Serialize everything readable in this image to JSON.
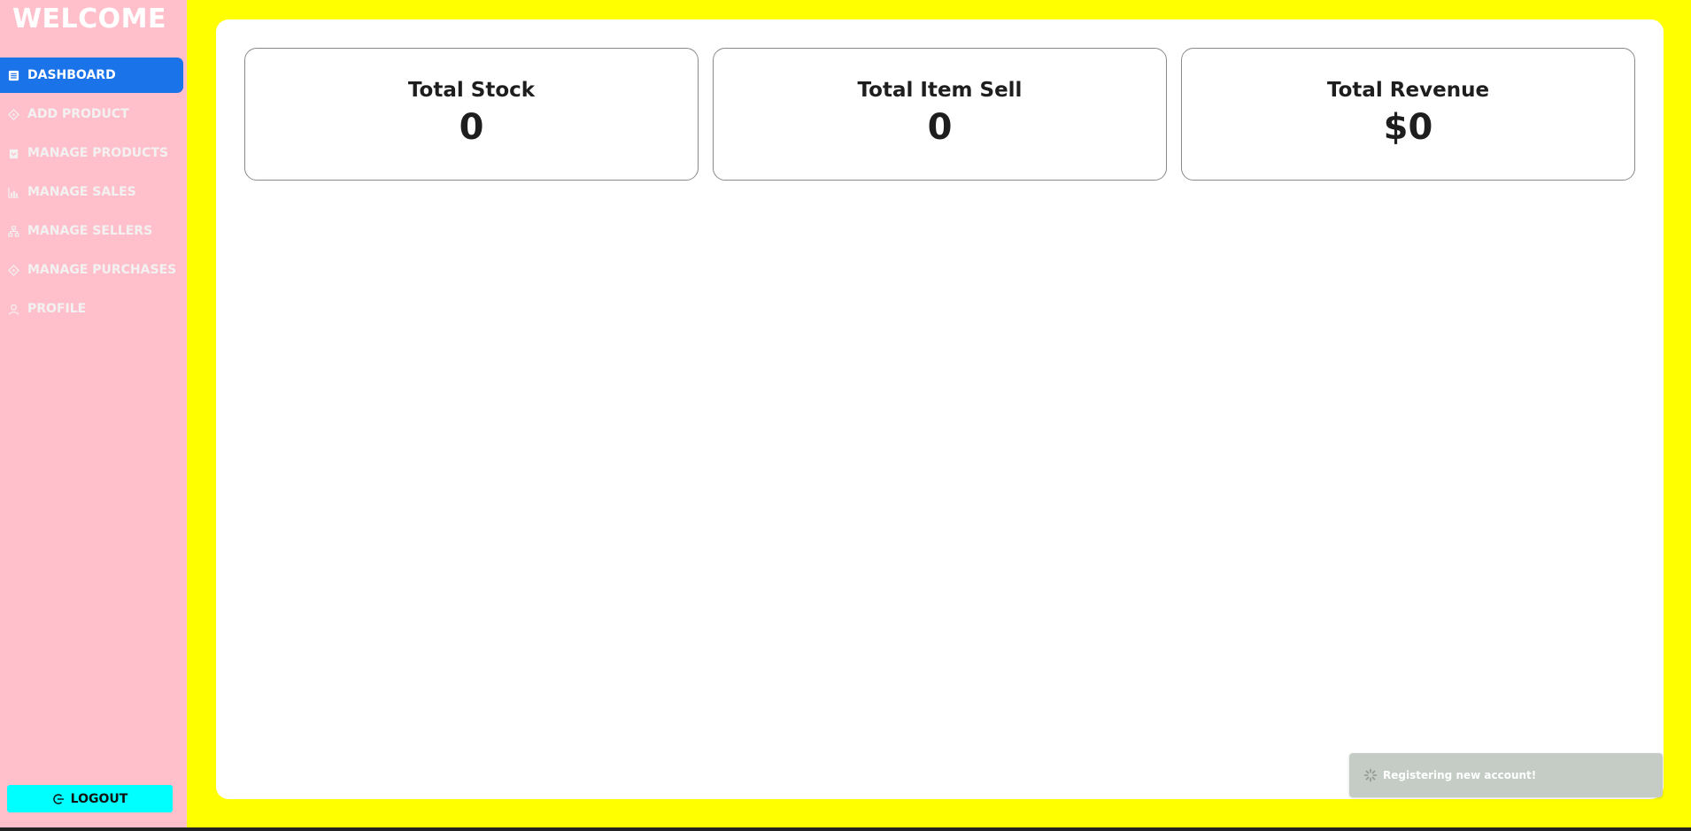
{
  "sidebar": {
    "title": "WELCOME",
    "items": [
      {
        "label": "DASHBOARD",
        "icon": "dashboard-icon",
        "active": true
      },
      {
        "label": "ADD PRODUCT",
        "icon": "diamond-icon"
      },
      {
        "label": "MANAGE PRODUCTS",
        "icon": "box-icon"
      },
      {
        "label": "MANAGE SALES",
        "icon": "bar-chart-icon"
      },
      {
        "label": "MANAGE SELLERS",
        "icon": "sitemap-icon"
      },
      {
        "label": "MANAGE PURCHASES",
        "icon": "diamond-icon"
      },
      {
        "label": "PROFILE",
        "icon": "user-icon"
      }
    ],
    "logout_label": "LOGOUT"
  },
  "cards": [
    {
      "label": "Total Stock",
      "value": "0"
    },
    {
      "label": "Total Item Sell",
      "value": "0"
    },
    {
      "label": "Total Revenue",
      "value": "$0"
    }
  ],
  "toast": {
    "message": "Registering new account!"
  },
  "colors": {
    "background": "#ffff00",
    "sidebar": "#ffc0cb",
    "active_item": "#1a73e8",
    "logout_button": "#00ffff",
    "toast": "#c4ccc5"
  }
}
